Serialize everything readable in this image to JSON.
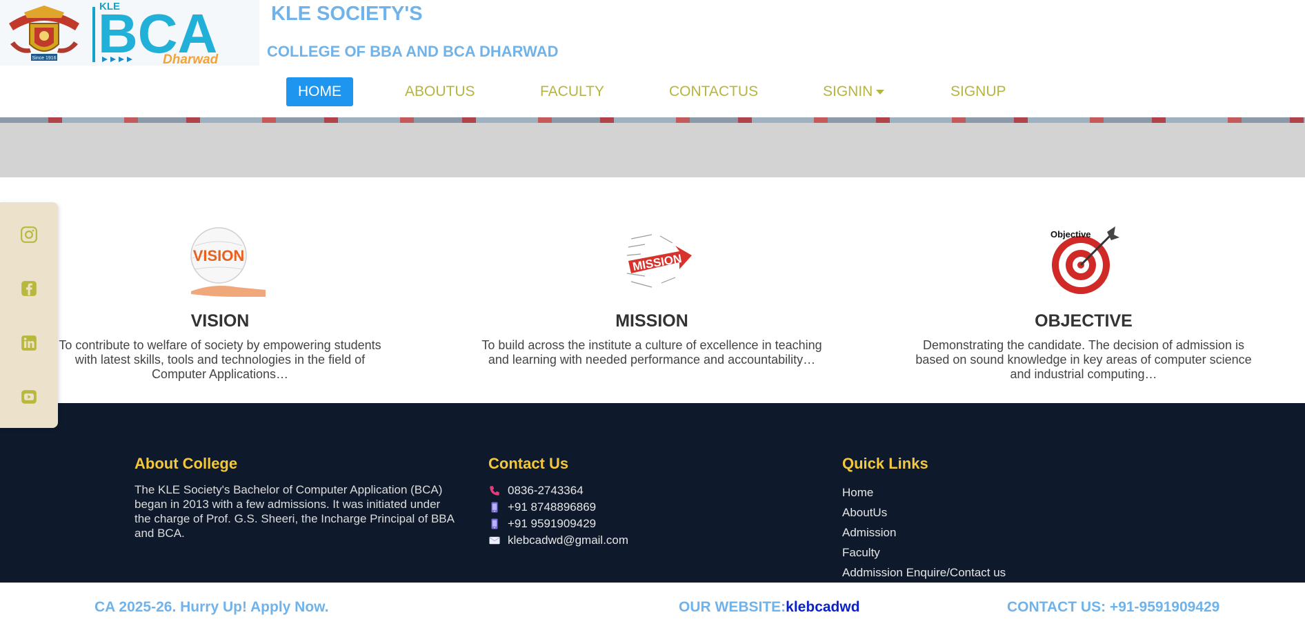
{
  "header": {
    "logo_emblem_text": "Since 1916",
    "logo_brand": "KLE",
    "logo_main": "BCA",
    "logo_city": "Dharwad",
    "title": "KLE SOCIETY'S",
    "subtitle": "COLLEGE OF BBA AND BCA DHARWAD"
  },
  "nav": {
    "items": [
      {
        "label": "HOME"
      },
      {
        "label": "ABOUTUS"
      },
      {
        "label": "FACULTY"
      },
      {
        "label": "CONTACTUS"
      },
      {
        "label": "SIGNIN"
      },
      {
        "label": "SIGNUP"
      }
    ]
  },
  "social": [
    "instagram-icon",
    "facebook-icon",
    "linkedin-icon",
    "youtube-icon"
  ],
  "features": [
    {
      "title": "VISION",
      "image_label": "VISION",
      "text": "To contribute to welfare of society by empowering students with latest skills, tools and technologies in the field of Computer Applications…"
    },
    {
      "title": "MISSION",
      "image_label": "MISSION",
      "text": "To build across the institute a culture of excellence in teaching and learning with needed performance and accountability…"
    },
    {
      "title": "OBJECTIVE",
      "image_label": "Objective",
      "text": "Demonstrating the candidate. The decision of admission is based on sound knowledge in key areas of computer science and industrial computing…"
    }
  ],
  "footer": {
    "about": {
      "heading": "About College",
      "text": "The KLE Society's Bachelor of Computer Application (BCA) began in 2013 with a few admissions. It was initiated under the charge of Prof. G.S. Sheeri, the Incharge Principal of BBA and BCA."
    },
    "contact": {
      "heading": "Contact Us",
      "lines": [
        "0836-2743364",
        "+91 8748896869",
        "+91 9591909429",
        "klebcadwd@gmail.com"
      ]
    },
    "links": {
      "heading": "Quick Links",
      "items": [
        "Home",
        "AboutUs",
        "Admission",
        "Faculty",
        "Addmission Enquire/Contact us"
      ]
    }
  },
  "ticker": {
    "admission": "CA 2025-26. Hurry Up! Apply Now.",
    "website_label": "OUR WEBSITE:",
    "website_link": "klebcadwd",
    "contact": "CONTACT US: +91-9591909429"
  },
  "colors": {
    "accent_blue": "#6fb3ea",
    "nav_active": "#1e96f0",
    "nav_text": "#b5b53f",
    "footer_bg": "#0e1a2b",
    "footer_heading": "#f5c83a",
    "sidebar_bg": "#ece2cb"
  }
}
